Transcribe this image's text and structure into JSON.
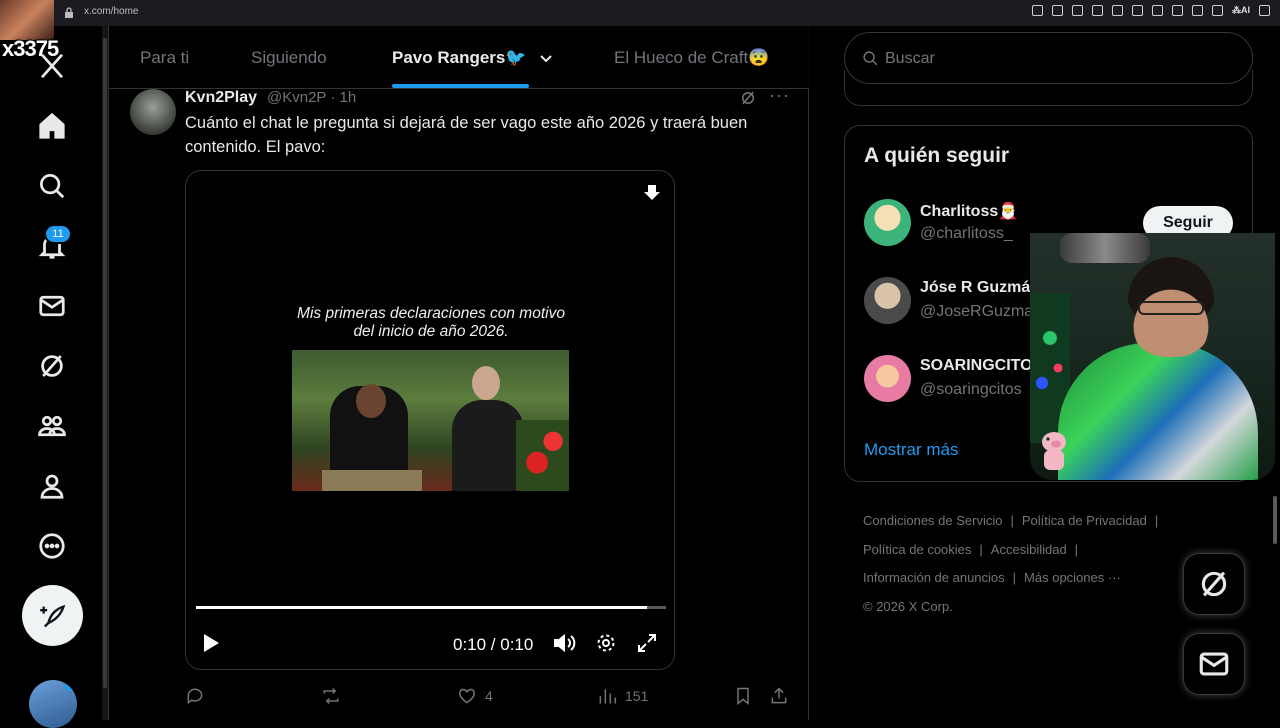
{
  "browser": {
    "url": "x.com/home"
  },
  "stream": {
    "label": "x3375"
  },
  "nav": {
    "notifications_badge": "11"
  },
  "tabs": [
    {
      "label": "Para ti"
    },
    {
      "label": "Siguiendo"
    },
    {
      "label": "Pavo Rangers🐦"
    },
    {
      "label": "El Hueco de Craft😨"
    }
  ],
  "tweet": {
    "name": "Kvn2Play",
    "handle": "@Kvn2P · 1h",
    "text": "Cuánto el chat le pregunta si dejará de ser vago este año 2026 y traerá buen contenido. El pavo:",
    "caption": "Mis primeras declaraciones con motivo del inicio de año 2026.",
    "video_time": "0:10 / 0:10",
    "video_progress": 0.96,
    "likes": "4",
    "views": "151"
  },
  "search": {
    "placeholder": "Buscar"
  },
  "who_to_follow": {
    "title": "A quién seguir",
    "users": [
      {
        "name": "Charlitoss🎅",
        "handle": "@charlitoss_",
        "avatar_color": "#3bb37a"
      },
      {
        "name": "Jóse R Guzmán",
        "handle": "@JoseRGuzman",
        "avatar_color": "#c9b7a1"
      },
      {
        "name": "SOARINGCITOS",
        "handle": "@soaringcitos",
        "avatar_color": "#e77ba4"
      }
    ],
    "follow_button": "Seguir",
    "show_more": "Mostrar más"
  },
  "footer": {
    "links": [
      "Condiciones de Servicio",
      "Política de Privacidad",
      "Política de cookies",
      "Accesibilidad",
      "Información de anuncios",
      "Más opciones ···"
    ],
    "copyright": "© 2026 X Corp."
  },
  "colors": {
    "accent": "#1d9bf0",
    "background": "#000000",
    "muted": "#71767b"
  }
}
